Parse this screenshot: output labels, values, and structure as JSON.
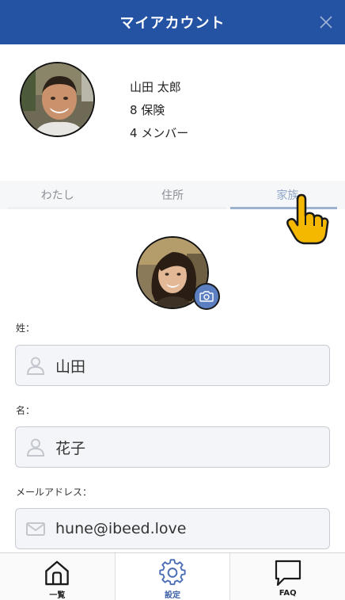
{
  "header": {
    "title": "マイアカウント",
    "close_icon": "close-icon"
  },
  "profile": {
    "name": "山田 太郎",
    "insurance_count": "8 保険",
    "member_count": "4 メンバー"
  },
  "tabs": [
    {
      "label": "わたし",
      "active": false
    },
    {
      "label": "住所",
      "active": false
    },
    {
      "label": "家族",
      "active": true
    }
  ],
  "form": {
    "last_name_label": "姓：",
    "last_name_value": "山田",
    "first_name_label": "名：",
    "first_name_value": "花子",
    "email_label": "メールアドレス：",
    "email_value": "hune@ibeed.love"
  },
  "bottom_nav": [
    {
      "label": "一覧",
      "icon": "home-icon",
      "active": false
    },
    {
      "label": "設定",
      "icon": "gear-icon",
      "active": true
    },
    {
      "label": "FAQ",
      "icon": "chat-bubble-icon",
      "active": false
    }
  ],
  "colors": {
    "header_bg": "#2553a3",
    "active_tab": "#8fa6c8",
    "nav_active": "#3b5fa8",
    "camera_bg": "#5b7fc0"
  }
}
